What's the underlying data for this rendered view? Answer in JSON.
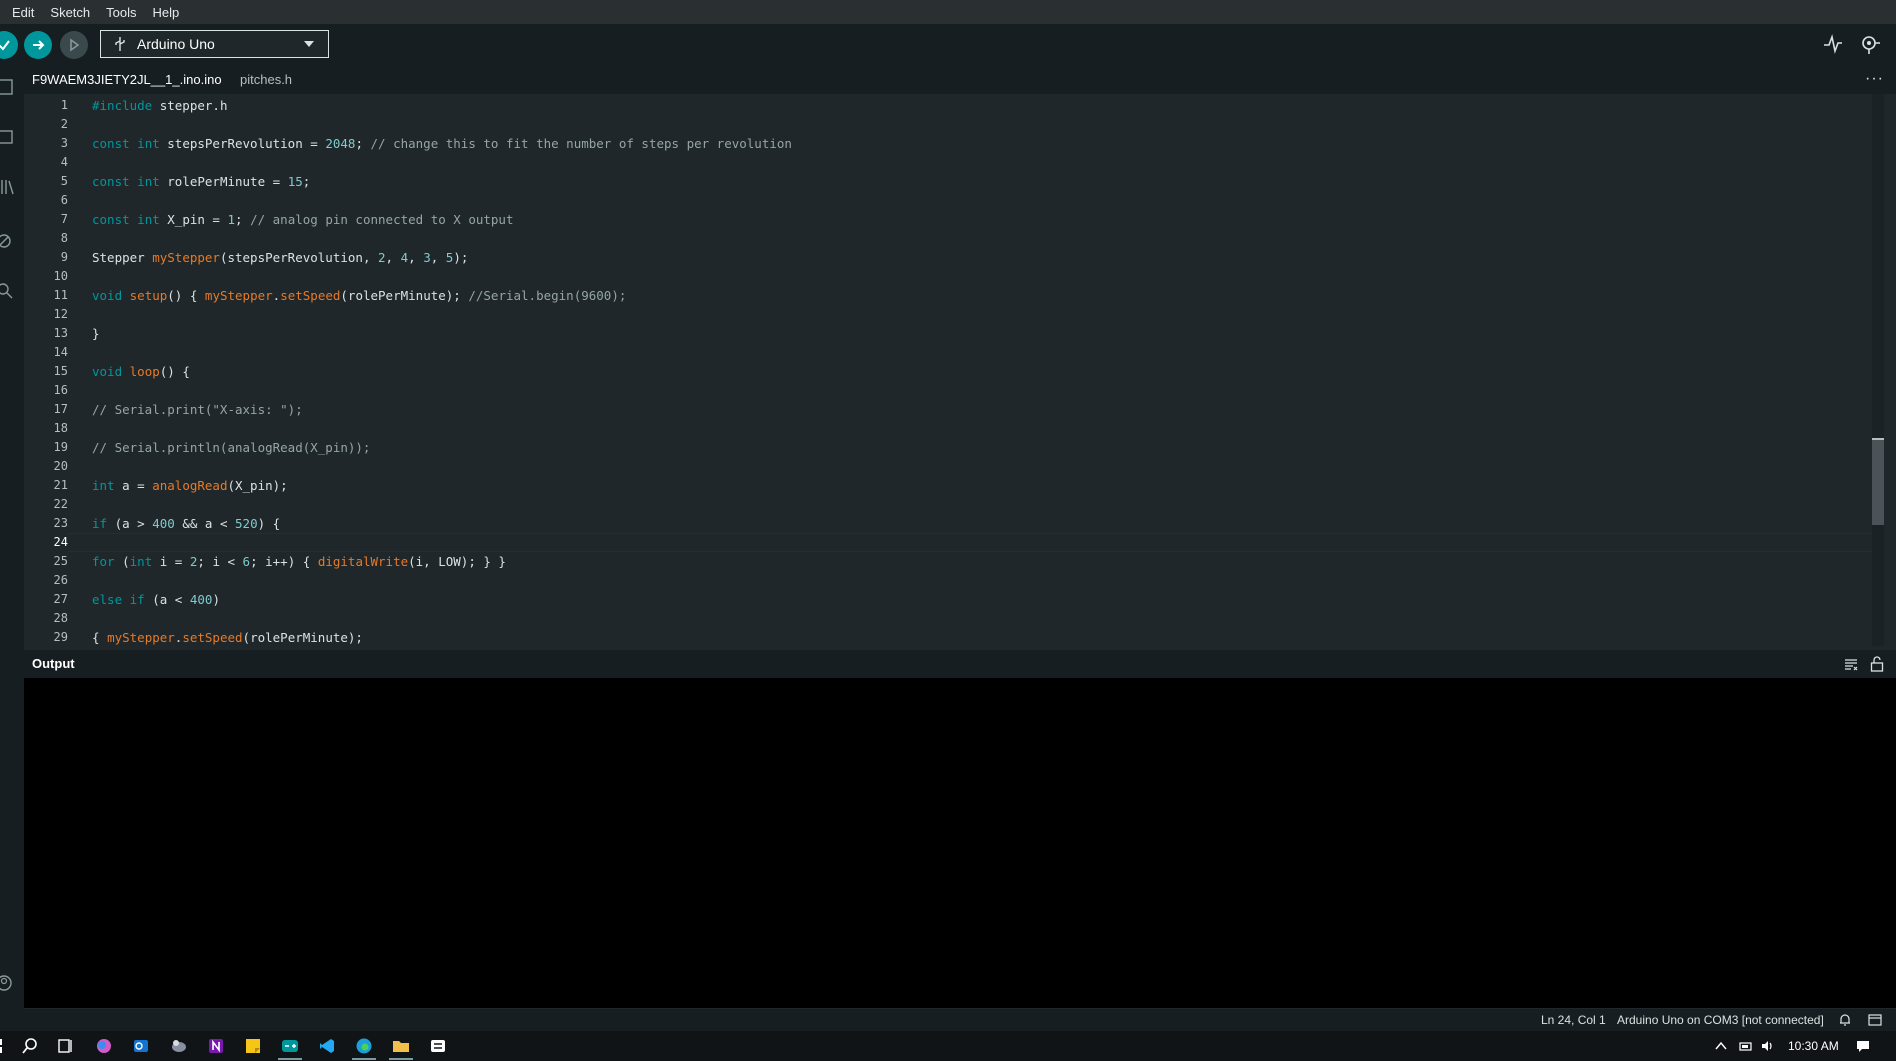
{
  "menu": [
    "Edit",
    "Sketch",
    "Tools",
    "Help"
  ],
  "toolbar": {
    "board": "Arduino Uno"
  },
  "tabs": [
    {
      "label": "F9WAEM3JIETY2JL__1_.ino.ino"
    },
    {
      "label": "pitches.h"
    }
  ],
  "tab_overflow": "···",
  "editor": {
    "active_line": 24,
    "lines": [
      [
        {
          "t": "#include ",
          "c": "pp"
        },
        {
          "t": "stepper.h",
          "c": ""
        }
      ],
      [],
      [
        {
          "t": "const",
          "c": "kw"
        },
        {
          "t": " ",
          "c": ""
        },
        {
          "t": "int",
          "c": "kw"
        },
        {
          "t": " stepsPerRevolution = ",
          "c": ""
        },
        {
          "t": "2048",
          "c": "num"
        },
        {
          "t": "; ",
          "c": ""
        },
        {
          "t": "// change this to fit the number of steps per revolution",
          "c": "cm"
        }
      ],
      [],
      [
        {
          "t": "const",
          "c": "kw"
        },
        {
          "t": " ",
          "c": ""
        },
        {
          "t": "int",
          "c": "kw"
        },
        {
          "t": " rolePerMinute = ",
          "c": ""
        },
        {
          "t": "15",
          "c": "num"
        },
        {
          "t": ";",
          "c": ""
        }
      ],
      [],
      [
        {
          "t": "const",
          "c": "kw"
        },
        {
          "t": " ",
          "c": ""
        },
        {
          "t": "int",
          "c": "kw"
        },
        {
          "t": " X_pin = ",
          "c": ""
        },
        {
          "t": "1",
          "c": "num"
        },
        {
          "t": "; ",
          "c": ""
        },
        {
          "t": "// analog pin connected to X output",
          "c": "cm"
        }
      ],
      [],
      [
        {
          "t": "Stepper ",
          "c": ""
        },
        {
          "t": "myStepper",
          "c": "fn"
        },
        {
          "t": "(stepsPerRevolution, ",
          "c": ""
        },
        {
          "t": "2",
          "c": "num"
        },
        {
          "t": ", ",
          "c": ""
        },
        {
          "t": "4",
          "c": "num"
        },
        {
          "t": ", ",
          "c": ""
        },
        {
          "t": "3",
          "c": "num"
        },
        {
          "t": ", ",
          "c": ""
        },
        {
          "t": "5",
          "c": "num"
        },
        {
          "t": ");",
          "c": ""
        }
      ],
      [],
      [
        {
          "t": "void",
          "c": "kw"
        },
        {
          "t": " ",
          "c": ""
        },
        {
          "t": "setup",
          "c": "fn"
        },
        {
          "t": "() { ",
          "c": ""
        },
        {
          "t": "myStepper",
          "c": "fn"
        },
        {
          "t": ".",
          "c": ""
        },
        {
          "t": "setSpeed",
          "c": "fn"
        },
        {
          "t": "(rolePerMinute); ",
          "c": ""
        },
        {
          "t": "//Serial.begin(9600);",
          "c": "cm"
        }
      ],
      [],
      [
        {
          "t": "}",
          "c": ""
        }
      ],
      [],
      [
        {
          "t": "void",
          "c": "kw"
        },
        {
          "t": " ",
          "c": ""
        },
        {
          "t": "loop",
          "c": "fn"
        },
        {
          "t": "() {",
          "c": ""
        }
      ],
      [],
      [
        {
          "t": "// Serial.print(\"X-axis: \");",
          "c": "cm"
        }
      ],
      [],
      [
        {
          "t": "// Serial.println(analogRead(X_pin));",
          "c": "cm"
        }
      ],
      [],
      [
        {
          "t": "int",
          "c": "kw"
        },
        {
          "t": " a = ",
          "c": ""
        },
        {
          "t": "analogRead",
          "c": "fn"
        },
        {
          "t": "(X_pin);",
          "c": ""
        }
      ],
      [],
      [
        {
          "t": "if",
          "c": "kw"
        },
        {
          "t": " (a > ",
          "c": ""
        },
        {
          "t": "400",
          "c": "num"
        },
        {
          "t": " && a < ",
          "c": ""
        },
        {
          "t": "520",
          "c": "num"
        },
        {
          "t": ") {",
          "c": ""
        }
      ],
      [],
      [
        {
          "t": "for",
          "c": "kw"
        },
        {
          "t": " (",
          "c": ""
        },
        {
          "t": "int",
          "c": "kw"
        },
        {
          "t": " i = ",
          "c": ""
        },
        {
          "t": "2",
          "c": "num"
        },
        {
          "t": "; i < ",
          "c": ""
        },
        {
          "t": "6",
          "c": "num"
        },
        {
          "t": "; i++) { ",
          "c": ""
        },
        {
          "t": "digitalWrite",
          "c": "fn"
        },
        {
          "t": "(i, LOW); } }",
          "c": ""
        }
      ],
      [],
      [
        {
          "t": "else",
          "c": "kw"
        },
        {
          "t": " ",
          "c": ""
        },
        {
          "t": "if",
          "c": "kw"
        },
        {
          "t": " (a < ",
          "c": ""
        },
        {
          "t": "400",
          "c": "num"
        },
        {
          "t": ")",
          "c": ""
        }
      ],
      [],
      [
        {
          "t": "{ ",
          "c": ""
        },
        {
          "t": "myStepper",
          "c": "fn"
        },
        {
          "t": ".",
          "c": ""
        },
        {
          "t": "setSpeed",
          "c": "fn"
        },
        {
          "t": "(rolePerMinute);",
          "c": ""
        }
      ]
    ]
  },
  "output": {
    "title": "Output"
  },
  "status": {
    "cursor": "Ln 24, Col 1",
    "board": "Arduino Uno on COM3 [not connected]"
  },
  "taskbar": {
    "time": "10:30 AM"
  },
  "colors": {
    "accent": "#00979c",
    "function": "#e97925",
    "number": "#7fcbcd",
    "comment": "#95a5a6",
    "editor_bg": "#1f272a",
    "toolbar_bg": "#171e21"
  }
}
